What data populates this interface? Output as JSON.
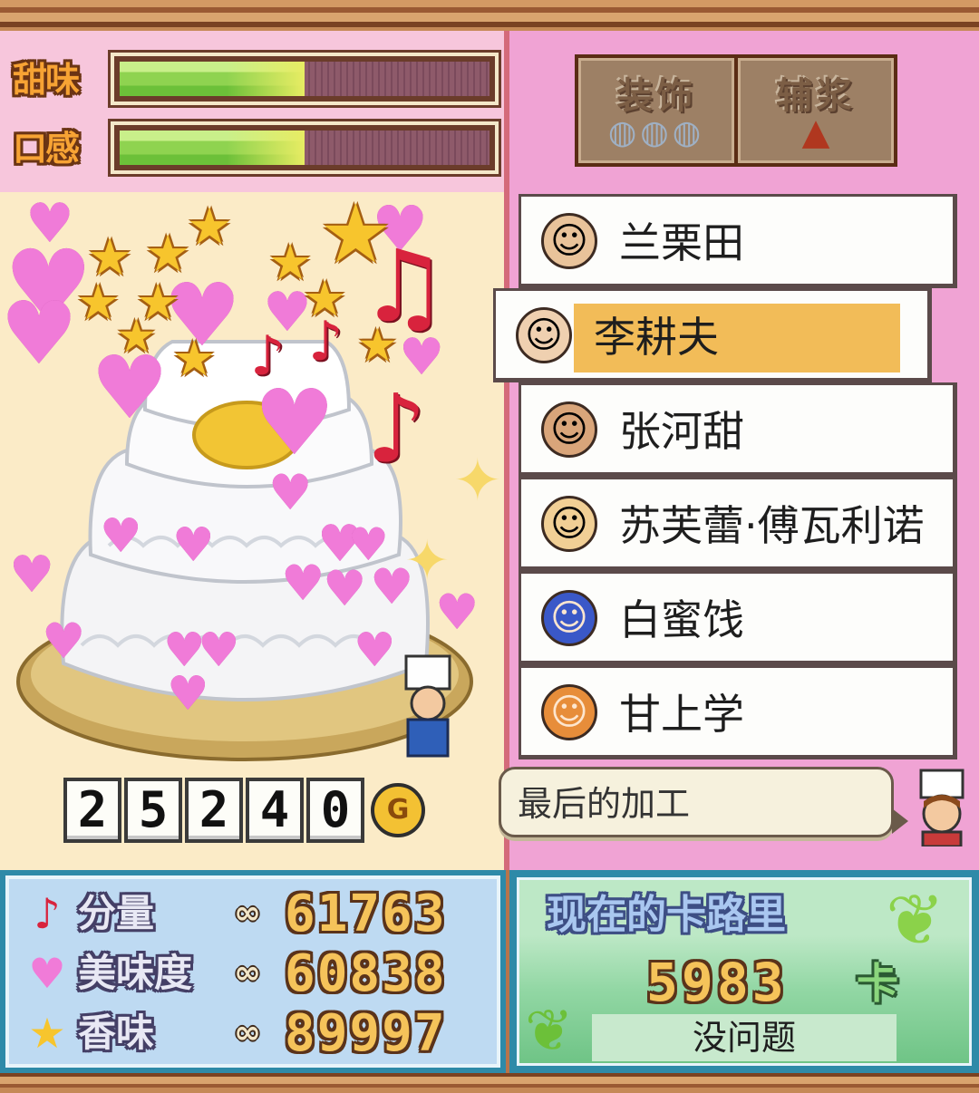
{
  "meters": [
    {
      "label": "甜味",
      "fill": 0.5
    },
    {
      "label": "口感",
      "fill": 0.5
    }
  ],
  "tabs": {
    "decoration": "装饰",
    "ingredient": "辅浆"
  },
  "price": {
    "digits": [
      "2",
      "5",
      "2",
      "4",
      "0"
    ],
    "coin_symbol": "G"
  },
  "staff": [
    {
      "name": "兰栗田",
      "selected": false
    },
    {
      "name": "李耕夫",
      "selected": true
    },
    {
      "name": "张河甜",
      "selected": false
    },
    {
      "name": "苏芙蕾·傅瓦利诺",
      "selected": false
    },
    {
      "name": "白蜜饯",
      "selected": false
    },
    {
      "name": "甘上学",
      "selected": false
    }
  ],
  "speech": {
    "text": "最后的加工"
  },
  "stats": [
    {
      "icon": "music-note-icon",
      "label": "分量",
      "inf": "∞",
      "value": "61763"
    },
    {
      "icon": "heart-icon",
      "label": "美味度",
      "inf": "∞",
      "value": "60838"
    },
    {
      "icon": "star-icon",
      "label": "香味",
      "inf": "∞",
      "value": "89997"
    }
  ],
  "calorie": {
    "title": "现在的卡路里",
    "value": "5983",
    "unit": "卡",
    "status": "没问题"
  },
  "colors": {
    "meter_label": "#f7a334",
    "right_panel": "#f0a3d4",
    "selected_highlight": "#f2bc58",
    "stats_bg": "#bedaf2",
    "calorie_bg": "#92d7a4"
  }
}
